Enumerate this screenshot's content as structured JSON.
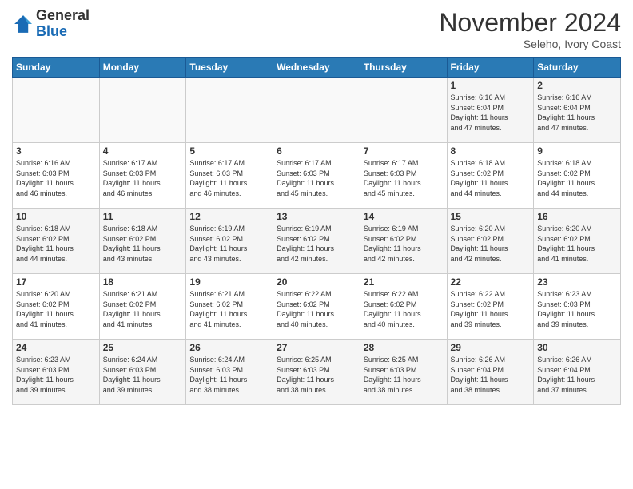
{
  "header": {
    "logo_line1": "General",
    "logo_line2": "Blue",
    "month_title": "November 2024",
    "subtitle": "Seleho, Ivory Coast"
  },
  "weekdays": [
    "Sunday",
    "Monday",
    "Tuesday",
    "Wednesday",
    "Thursday",
    "Friday",
    "Saturday"
  ],
  "weeks": [
    [
      {
        "day": "",
        "info": ""
      },
      {
        "day": "",
        "info": ""
      },
      {
        "day": "",
        "info": ""
      },
      {
        "day": "",
        "info": ""
      },
      {
        "day": "",
        "info": ""
      },
      {
        "day": "1",
        "info": "Sunrise: 6:16 AM\nSunset: 6:04 PM\nDaylight: 11 hours\nand 47 minutes."
      },
      {
        "day": "2",
        "info": "Sunrise: 6:16 AM\nSunset: 6:04 PM\nDaylight: 11 hours\nand 47 minutes."
      }
    ],
    [
      {
        "day": "3",
        "info": "Sunrise: 6:16 AM\nSunset: 6:03 PM\nDaylight: 11 hours\nand 46 minutes."
      },
      {
        "day": "4",
        "info": "Sunrise: 6:17 AM\nSunset: 6:03 PM\nDaylight: 11 hours\nand 46 minutes."
      },
      {
        "day": "5",
        "info": "Sunrise: 6:17 AM\nSunset: 6:03 PM\nDaylight: 11 hours\nand 46 minutes."
      },
      {
        "day": "6",
        "info": "Sunrise: 6:17 AM\nSunset: 6:03 PM\nDaylight: 11 hours\nand 45 minutes."
      },
      {
        "day": "7",
        "info": "Sunrise: 6:17 AM\nSunset: 6:03 PM\nDaylight: 11 hours\nand 45 minutes."
      },
      {
        "day": "8",
        "info": "Sunrise: 6:18 AM\nSunset: 6:02 PM\nDaylight: 11 hours\nand 44 minutes."
      },
      {
        "day": "9",
        "info": "Sunrise: 6:18 AM\nSunset: 6:02 PM\nDaylight: 11 hours\nand 44 minutes."
      }
    ],
    [
      {
        "day": "10",
        "info": "Sunrise: 6:18 AM\nSunset: 6:02 PM\nDaylight: 11 hours\nand 44 minutes."
      },
      {
        "day": "11",
        "info": "Sunrise: 6:18 AM\nSunset: 6:02 PM\nDaylight: 11 hours\nand 43 minutes."
      },
      {
        "day": "12",
        "info": "Sunrise: 6:19 AM\nSunset: 6:02 PM\nDaylight: 11 hours\nand 43 minutes."
      },
      {
        "day": "13",
        "info": "Sunrise: 6:19 AM\nSunset: 6:02 PM\nDaylight: 11 hours\nand 42 minutes."
      },
      {
        "day": "14",
        "info": "Sunrise: 6:19 AM\nSunset: 6:02 PM\nDaylight: 11 hours\nand 42 minutes."
      },
      {
        "day": "15",
        "info": "Sunrise: 6:20 AM\nSunset: 6:02 PM\nDaylight: 11 hours\nand 42 minutes."
      },
      {
        "day": "16",
        "info": "Sunrise: 6:20 AM\nSunset: 6:02 PM\nDaylight: 11 hours\nand 41 minutes."
      }
    ],
    [
      {
        "day": "17",
        "info": "Sunrise: 6:20 AM\nSunset: 6:02 PM\nDaylight: 11 hours\nand 41 minutes."
      },
      {
        "day": "18",
        "info": "Sunrise: 6:21 AM\nSunset: 6:02 PM\nDaylight: 11 hours\nand 41 minutes."
      },
      {
        "day": "19",
        "info": "Sunrise: 6:21 AM\nSunset: 6:02 PM\nDaylight: 11 hours\nand 41 minutes."
      },
      {
        "day": "20",
        "info": "Sunrise: 6:22 AM\nSunset: 6:02 PM\nDaylight: 11 hours\nand 40 minutes."
      },
      {
        "day": "21",
        "info": "Sunrise: 6:22 AM\nSunset: 6:02 PM\nDaylight: 11 hours\nand 40 minutes."
      },
      {
        "day": "22",
        "info": "Sunrise: 6:22 AM\nSunset: 6:02 PM\nDaylight: 11 hours\nand 39 minutes."
      },
      {
        "day": "23",
        "info": "Sunrise: 6:23 AM\nSunset: 6:03 PM\nDaylight: 11 hours\nand 39 minutes."
      }
    ],
    [
      {
        "day": "24",
        "info": "Sunrise: 6:23 AM\nSunset: 6:03 PM\nDaylight: 11 hours\nand 39 minutes."
      },
      {
        "day": "25",
        "info": "Sunrise: 6:24 AM\nSunset: 6:03 PM\nDaylight: 11 hours\nand 39 minutes."
      },
      {
        "day": "26",
        "info": "Sunrise: 6:24 AM\nSunset: 6:03 PM\nDaylight: 11 hours\nand 38 minutes."
      },
      {
        "day": "27",
        "info": "Sunrise: 6:25 AM\nSunset: 6:03 PM\nDaylight: 11 hours\nand 38 minutes."
      },
      {
        "day": "28",
        "info": "Sunrise: 6:25 AM\nSunset: 6:03 PM\nDaylight: 11 hours\nand 38 minutes."
      },
      {
        "day": "29",
        "info": "Sunrise: 6:26 AM\nSunset: 6:04 PM\nDaylight: 11 hours\nand 38 minutes."
      },
      {
        "day": "30",
        "info": "Sunrise: 6:26 AM\nSunset: 6:04 PM\nDaylight: 11 hours\nand 37 minutes."
      }
    ]
  ]
}
